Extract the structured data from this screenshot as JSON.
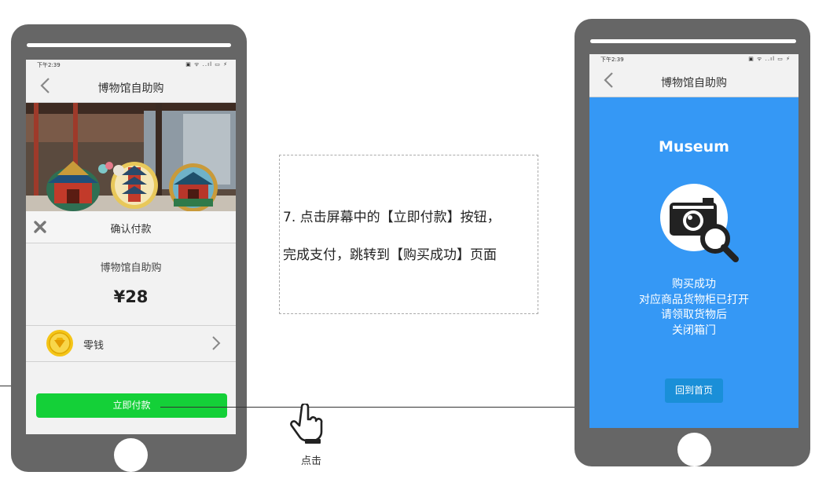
{
  "left_phone": {
    "status_time": "下午2:39",
    "status_icons": "▣ ᯤ ..ıl ▭ ⚡",
    "nav_title": "博物馆自助购",
    "sheet_title": "确认付款",
    "merchant_name": "博物馆自助购",
    "amount": "¥28",
    "payment_method": "零钱",
    "pay_button": "立即付款"
  },
  "right_phone": {
    "status_time": "下午2:39",
    "status_icons": "▣ ᯤ ..ıl ▭ ⚡",
    "nav_title": "博物馆自助购",
    "brand": "Museum",
    "message_lines": [
      "购买成功",
      "对应商品货物柜已打开",
      "请领取货物后",
      "关闭箱门"
    ],
    "home_button": "回到首页"
  },
  "annotation": {
    "line1": "7. 点击屏幕中的【立即付款】按钮，",
    "line2": "完成支付，跳转到【购买成功】页面",
    "click_label": "点击"
  },
  "colors": {
    "phone_body": "#666666",
    "pay_green": "#14d038",
    "success_blue": "#3598f5",
    "coin_yellow": "#f5c518"
  }
}
